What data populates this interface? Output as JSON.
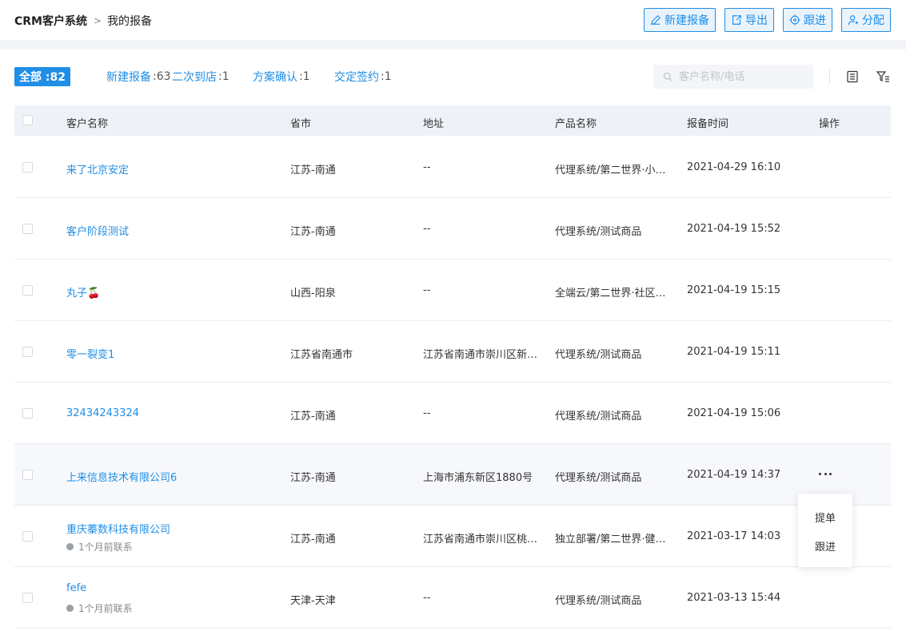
{
  "breadcrumb": {
    "root": "CRM客户系统",
    "current": "我的报备"
  },
  "toolbar": {
    "new_label": "新建报备",
    "export_label": "导出",
    "follow_label": "跟进",
    "assign_label": "分配"
  },
  "filters": {
    "all_label": "全部 :82",
    "tabs": [
      {
        "label": "新建报备",
        "count": ":63"
      },
      {
        "label": "二次到店",
        "count": ":1"
      },
      {
        "label": "方案确认",
        "count": ":1"
      },
      {
        "label": "交定签约",
        "count": ":1"
      }
    ]
  },
  "search": {
    "placeholder": "客户名称/电话"
  },
  "table": {
    "headers": [
      "客户名称",
      "省市",
      "地址",
      "产品名称",
      "报备时间",
      "操作"
    ],
    "rows": [
      {
        "name": "来了北京安定",
        "sub": "",
        "province": "江苏-南通",
        "address": "--",
        "product": "代理系统/第二世界·小程序",
        "time": "2021-04-29 16:10"
      },
      {
        "name": "客户阶段测试",
        "sub": "",
        "province": "江苏-南通",
        "address": "--",
        "product": "代理系统/测试商品",
        "time": "2021-04-19 15:52"
      },
      {
        "name": "丸子🍒",
        "sub": "",
        "province": "山西-阳泉",
        "address": "--",
        "product": "全端云/第二世界·社区团购",
        "time": "2021-04-19 15:15"
      },
      {
        "name": "零一裂变1",
        "sub": "",
        "province": "江苏省南通市",
        "address": "江苏省南通市崇川区新城桥",
        "product": "代理系统/测试商品",
        "time": "2021-04-19 15:11"
      },
      {
        "name": "32434243324",
        "sub": "",
        "province": "江苏-南通",
        "address": "--",
        "product": "代理系统/测试商品",
        "time": "2021-04-19 15:06"
      },
      {
        "name": "上来信息技术有限公司6",
        "sub": "",
        "province": "江苏-南通",
        "address": "上海市浦东新区1880号",
        "product": "代理系统/测试商品",
        "time": "2021-04-19 14:37"
      },
      {
        "name": "重庆蓁数科技有限公司",
        "sub": "1个月前联系",
        "province": "江苏-南通",
        "address": "江苏省南通市崇川区桃园路",
        "product": "独立部署/第二世界·健身房",
        "time": "2021-03-17 14:03"
      },
      {
        "name": "fefe",
        "sub": "1个月前联系",
        "province": "天津-天津",
        "address": "--",
        "product": "代理系统/测试商品",
        "time": "2021-03-13 15:44"
      }
    ]
  },
  "menu": {
    "items": [
      "提单",
      "跟进"
    ]
  },
  "colors": {
    "accent": "#1f8ee6",
    "header_bg": "#eef2f8",
    "band": "#f3f5f8"
  }
}
